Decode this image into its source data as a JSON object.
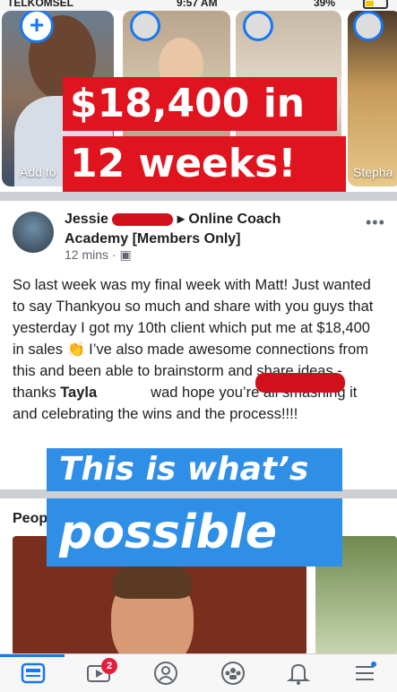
{
  "status_bar": {
    "carrier": "TELKOMSEL",
    "time": "9:57 AM",
    "battery": "39%"
  },
  "stories": {
    "add_label": "Add to",
    "last_label": "Stepha",
    "add_symbol": "+"
  },
  "overlays": {
    "line1": "$18,400 in",
    "line2": "12 weeks!",
    "line3": "This is what’s",
    "line4": "possible"
  },
  "post": {
    "author_first": "Jessie",
    "group_a": "Online Coach",
    "group_b": "Academy [Members Only]",
    "time": "12 mins",
    "more_icon": "•••",
    "text_1": "So last week was my final week with Matt! Just wanted to say Thankyou so much and share with you guys that yesterday I got my 10th client which put me at $18,400 in sales",
    "text_2": " I’ve also made awesome connections from this and been able to brainstorm and share ideas - thanks ",
    "mention": "Tayla",
    "mention_tail": "wad",
    "text_3": " hope you’re all smashing it and celebrating the wins and the process!!!!"
  },
  "people": {
    "title": "Peop"
  },
  "tabbar": {
    "video_badge": "2"
  },
  "colors": {
    "accent": "#1877f2",
    "banner_red": "#e0141e",
    "banner_blue": "#2f8fe6"
  }
}
